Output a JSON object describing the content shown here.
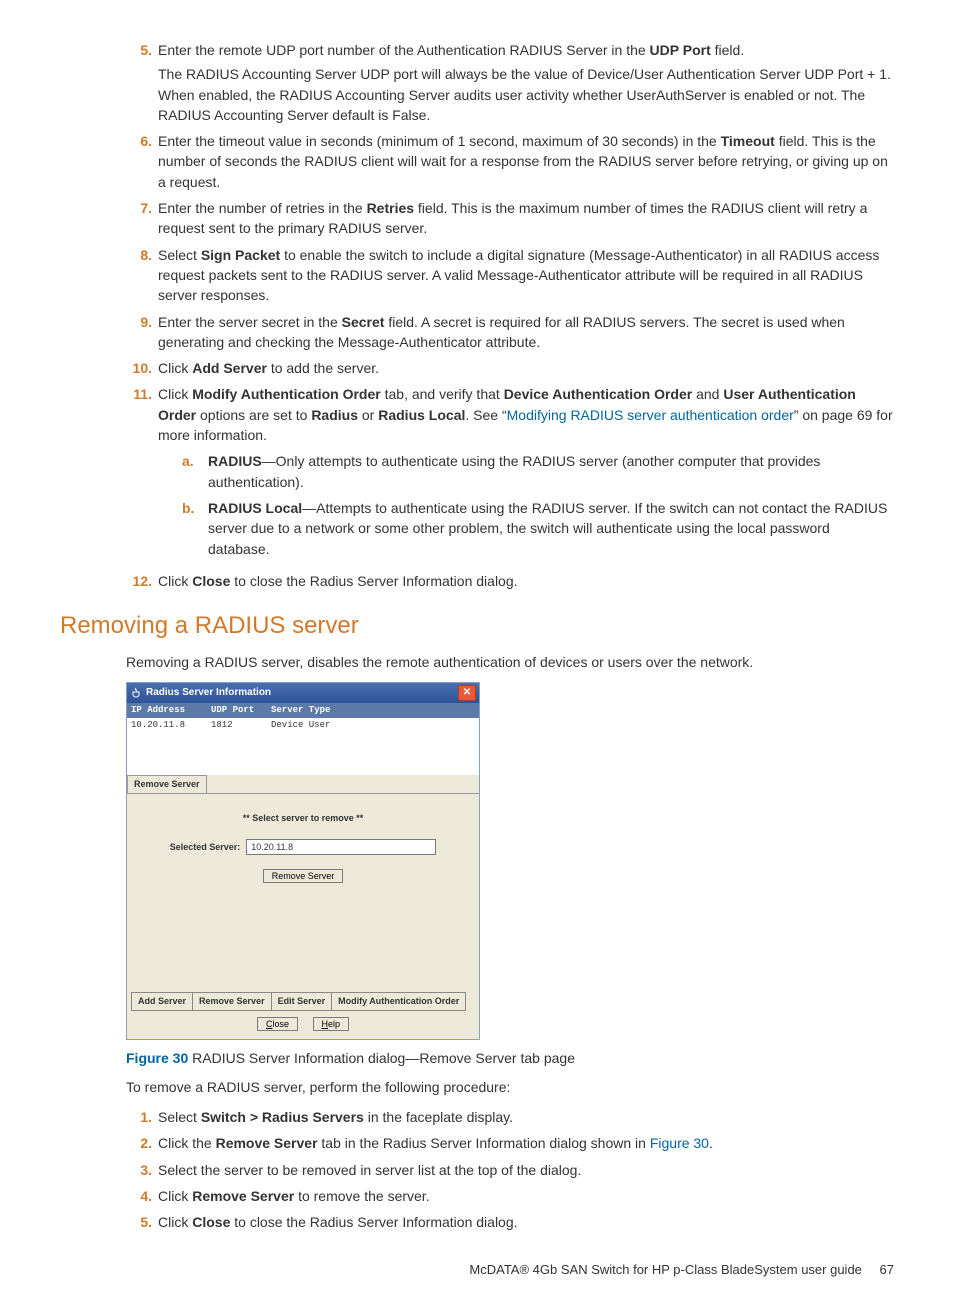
{
  "steps1": {
    "s5": {
      "num": "5.",
      "text_a": "Enter the remote UDP port number of the Authentication RADIUS Server in the ",
      "udp_port": "UDP Port",
      "text_b": " field.",
      "para2": "The RADIUS Accounting Server UDP port will always be the value of Device/User Authentication Server UDP Port + 1. When enabled, the RADIUS Accounting Server audits user activity whether UserAuthServer is enabled or not. The RADIUS Accounting Server default is False."
    },
    "s6": {
      "num": "6.",
      "text_a": "Enter the timeout value in seconds (minimum of 1 second, maximum of 30 seconds) in the ",
      "timeout": "Timeout",
      "text_b": " field. This is the number of seconds the RADIUS client will wait for a response from the RADIUS server before retrying, or giving up on a request."
    },
    "s7": {
      "num": "7.",
      "text_a": "Enter the number of retries in the ",
      "retries": "Retries",
      "text_b": " field. This is the maximum number of times the RADIUS client will retry a request sent to the primary RADIUS server."
    },
    "s8": {
      "num": "8.",
      "text_a": "Select ",
      "sign_packet": "Sign Packet",
      "text_b": " to enable the switch to include a digital signature (Message-Authenticator) in all RADIUS access request packets sent to the RADIUS server. A valid Message-Authenticator attribute will be required in all RADIUS server responses."
    },
    "s9": {
      "num": "9.",
      "text_a": "Enter the server secret in the ",
      "secret": "Secret",
      "text_b": " field. A secret is required for all RADIUS servers. The secret is used when generating and checking the Message-Authenticator attribute."
    },
    "s10": {
      "num": "10.",
      "text_a": "Click ",
      "add_server": "Add Server",
      "text_b": " to add the server."
    },
    "s11": {
      "num": "11.",
      "text_a": "Click ",
      "tab": "Modify Authentication Order",
      "text_b": " tab, and verify that ",
      "dao": "Device Authentication Order",
      "text_c": " and ",
      "uao": "User Authentication Order",
      "text_d": " options are set to ",
      "radius": "Radius",
      "text_e": " or ",
      "radius_local": "Radius Local",
      "text_f": ". See ",
      "link_open": "“",
      "link_text": "Modifying RADIUS server authentication order",
      "link_close": "” on page 69 for more information.",
      "sub_a": {
        "num": "a.",
        "radius": "RADIUS",
        "text": "—Only attempts to authenticate using the RADIUS server (another computer that provides authentication)."
      },
      "sub_b": {
        "num": "b.",
        "radius_local": "RADIUS Local",
        "text": "—Attempts to authenticate using the RADIUS server. If the switch can not contact the RADIUS server due to a network or some other problem, the switch will authenticate using the local password database."
      }
    },
    "s12": {
      "num": "12.",
      "text_a": "Click ",
      "close": "Close",
      "text_b": " to close the Radius Server Information dialog."
    }
  },
  "section_heading": "Removing a RADIUS server",
  "section_intro": "Removing a RADIUS server, disables the remote authentication of devices or users over the network.",
  "dialog": {
    "title": "Radius Server Information",
    "col1": "IP Address",
    "col2": "UDP Port",
    "col3": "Server Type",
    "row_ip": "10.20.11.8",
    "row_port": "1812",
    "row_type": "Device  User",
    "remove_server_tab": "Remove Server",
    "prompt": "** Select server to remove **",
    "selected_label": "Selected Server:",
    "selected_value": "10.20.11.8",
    "remove_btn": "Remove Server",
    "bottom_tabs": {
      "add": "Add Server",
      "remove": "Remove Server",
      "edit": "Edit Server",
      "modify": "Modify Authentication Order"
    },
    "close_c": "C",
    "close_rest": "lose",
    "help_h": "H",
    "help_rest": "elp"
  },
  "caption": {
    "label": "Figure 30",
    "text": "  RADIUS Server Information dialog—Remove Server tab page"
  },
  "steps2_intro": "To remove a RADIUS server, perform the following procedure:",
  "steps2": {
    "s1": {
      "num": "1.",
      "a": "Select ",
      "b": "Switch > Radius Servers",
      "c": " in the faceplate display."
    },
    "s2": {
      "num": "2.",
      "a": "Click the ",
      "b": "Remove Server",
      "c": " tab in the Radius Server Information dialog shown in ",
      "link": "Figure 30",
      "d": "."
    },
    "s3": {
      "num": "3.",
      "a": "Select the server to be removed in server list at the top of the dialog."
    },
    "s4": {
      "num": "4.",
      "a": "Click ",
      "b": "Remove Server",
      "c": " to remove the server."
    },
    "s5": {
      "num": "5.",
      "a": "Click ",
      "b": "Close",
      "c": " to close the Radius Server Information dialog."
    }
  },
  "footer": {
    "text": "McDATA® 4Gb SAN Switch for HP p-Class BladeSystem user guide",
    "page": "67"
  }
}
